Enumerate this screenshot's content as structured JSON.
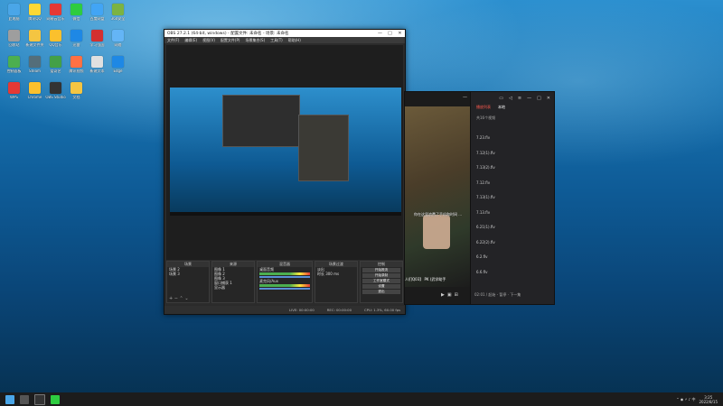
{
  "desktop_icons": [
    {
      "label": "此电脑",
      "color": "#4aa6e8"
    },
    {
      "label": "腾讯QQ",
      "color": "#fdd835"
    },
    {
      "label": "网易云音乐",
      "color": "#e53935"
    },
    {
      "label": "微信",
      "color": "#2ecc40"
    },
    {
      "label": "百度网盘",
      "color": "#42a5f5"
    },
    {
      "label": "360安全",
      "color": "#7cb342"
    },
    {
      "label": "回收站",
      "color": "#9e9e9e"
    },
    {
      "label": "新建文件夹",
      "color": "#f4c542"
    },
    {
      "label": "QQ音乐",
      "color": "#fbc02d"
    },
    {
      "label": "迅雷",
      "color": "#1e88e5"
    },
    {
      "label": "学习强国",
      "color": "#d32f2f"
    },
    {
      "label": "网络",
      "color": "#64b5f6"
    },
    {
      "label": "控制面板",
      "color": "#4caf50"
    },
    {
      "label": "Steam",
      "color": "#546e7a"
    },
    {
      "label": "爱奇艺",
      "color": "#43a047"
    },
    {
      "label": "腾讯视频",
      "color": "#ff7043"
    },
    {
      "label": "新建文本",
      "color": "#e0e0e0"
    },
    {
      "label": "Edge",
      "color": "#1e88e5"
    },
    {
      "label": "WPS",
      "color": "#e53935"
    },
    {
      "label": "Chrome",
      "color": "#fbc02d"
    },
    {
      "label": "OBS Studio",
      "color": "#333333"
    },
    {
      "label": "文档",
      "color": "#f4c542"
    }
  ],
  "obs": {
    "title": "OBS 27.2.1 (64-bit, windows) - 配置文件: 未命名 - 场景: 未命名",
    "minimize": "—",
    "maximize": "□",
    "close": "✕",
    "menu": [
      "文件(F)",
      "编辑(E)",
      "视图(V)",
      "配置文件(P)",
      "场景集合(S)",
      "工具(T)",
      "帮助(H)"
    ],
    "docks": {
      "scenes": {
        "title": "场景",
        "items": [
          "场景 2",
          "场景 3"
        ]
      },
      "sources": {
        "title": "来源",
        "items": [
          "图像 1",
          "图像 2",
          "图像 3",
          "窗口捕获 1",
          "显示器"
        ]
      },
      "mixer": {
        "title": "混音器",
        "items": [
          "桌面音频",
          "麦克风/Aux"
        ]
      },
      "transitions": {
        "title": "场景过渡",
        "fade": "淡出",
        "duration_label": "时长",
        "duration": "300 ms"
      },
      "controls": {
        "title": "控制",
        "buttons": [
          "开始推流",
          "开始录制",
          "工作室模式",
          "设置",
          "退出"
        ]
      }
    },
    "status": {
      "live": "LIVE: 00:00:00",
      "rec": "REC: 00:00:00",
      "cpu": "CPU: 1.3%, 60.00 fps"
    }
  },
  "player": {
    "subtitle": "你在这里浪费了手机和时间 ...",
    "caption": "人们Q03】 PK (武学助手",
    "close": "✕",
    "minimize": "—"
  },
  "playlist": {
    "tabs": [
      "播放列表",
      "本地"
    ],
    "active_tab": "播放列表",
    "count_label": "共16个视频",
    "items": [
      "7.23.flv",
      "7.12(1).flv",
      "7.13(2).flv",
      "7.12.flv",
      "7.13(1).flv",
      "7.13.flv",
      "6.21(1).flv",
      "6.22(2).flv",
      "6.2.flv",
      "6.6.flv"
    ],
    "footer": "02:01 / 起始 - 暂停 · 下一集"
  },
  "taskbar": {
    "time": "3:25",
    "date": "2022/8/15"
  }
}
